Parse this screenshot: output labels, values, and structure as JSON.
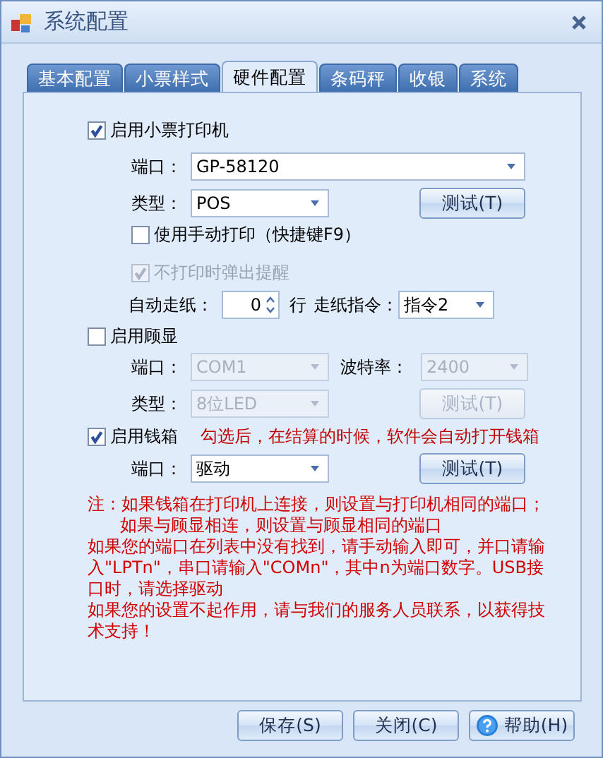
{
  "window": {
    "title": "系统配置"
  },
  "tabs": [
    {
      "label": "基本配置",
      "selected": false
    },
    {
      "label": "小票样式",
      "selected": false
    },
    {
      "label": "硬件配置",
      "selected": true
    },
    {
      "label": "条码秤",
      "selected": false
    },
    {
      "label": "收银",
      "selected": false
    },
    {
      "label": "系统",
      "selected": false
    }
  ],
  "printer": {
    "enabled": {
      "label": "启用小票打印机",
      "checked": true
    },
    "port": {
      "label": "端口：",
      "value": "GP-58120"
    },
    "type": {
      "label": "类型：",
      "value": "POS"
    },
    "test_button": {
      "label": "测试(T)",
      "disabled": false
    },
    "manual_print": {
      "label": "使用手动打印（快捷键F9）",
      "checked": false
    },
    "no_print_alert": {
      "label": "不打印时弹出提醒",
      "checked": true,
      "disabled": true
    },
    "auto_feed": {
      "label": "自动走纸：",
      "value": "0",
      "unit": "行"
    },
    "feed_command": {
      "label": "走纸指令：",
      "value": "指令2"
    }
  },
  "customer_display": {
    "enabled": {
      "label": "启用顾显",
      "checked": false
    },
    "port": {
      "label": "端口：",
      "value": "COM1",
      "disabled": true
    },
    "baud_rate": {
      "label": "波特率：",
      "value": "2400",
      "disabled": true
    },
    "type": {
      "label": "类型：",
      "value": "8位LED",
      "disabled": true
    },
    "test_button": {
      "label": "测试(T)",
      "disabled": true
    }
  },
  "cash_drawer": {
    "enabled": {
      "label": "启用钱箱",
      "checked": true
    },
    "hint": "勾选后，在结算的时候，软件会自动打开钱箱",
    "port": {
      "label": "端口：",
      "value": "驱动"
    },
    "test_button": {
      "label": "测试(T)",
      "disabled": false
    }
  },
  "notes": [
    {
      "kind": "plain",
      "text": "注：如果钱箱在打印机上连接，则设置与打印机相同的端口；"
    },
    {
      "kind": "indented",
      "text": "如果与顾显相连，则设置与顾显相同的端口"
    },
    {
      "kind": "plain",
      "text": "如果您的端口在列表中没有找到，请手动输入即可，并口请输入\"LPTn\"，串口请输入\"COMn\"，其中n为端口数字。USB接口时，请选择驱动"
    },
    {
      "kind": "plain",
      "text": "如果您的设置不起作用，请与我们的服务人员联系，以获得技术支持！"
    }
  ],
  "buttons": [
    {
      "label": "保存(S)",
      "kind": "plain"
    },
    {
      "label": "关闭(C)",
      "kind": "plain"
    },
    {
      "label": "帮助(H)",
      "kind": "help"
    }
  ]
}
